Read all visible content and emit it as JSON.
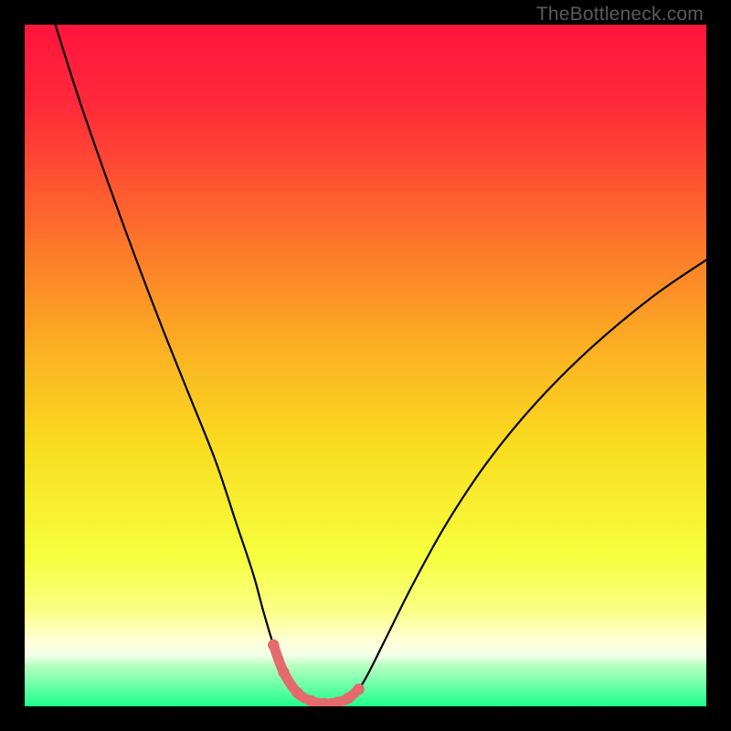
{
  "watermark": "TheBottleneck.com",
  "colors": {
    "frame": "#000000",
    "gradient_top": "#ff163d",
    "gradient_mid": "#f9dd20",
    "gradient_low": "#fbff80",
    "gradient_band": "#f7ffe0",
    "gradient_bottom": "#24ff8d",
    "curve": "#000000",
    "highlight": "#e46a6e"
  },
  "chart_data": {
    "type": "line",
    "title": "",
    "xlabel": "",
    "ylabel": "",
    "xlim": [
      0,
      100
    ],
    "ylim": [
      0,
      100
    ],
    "series": [
      {
        "name": "bottleneck-curve",
        "x": [
          4.5,
          8,
          12,
          16,
          20,
          24,
          28,
          31,
          33.5,
          35,
          36.5,
          38,
          40,
          42,
          44,
          46,
          47.5,
          49,
          50.5,
          53,
          57,
          62,
          68,
          75,
          83,
          92,
          100
        ],
        "y": [
          100,
          89,
          77.5,
          66.5,
          56,
          46,
          36,
          27,
          19.5,
          14,
          9,
          5,
          2,
          0.8,
          0.4,
          0.6,
          1.2,
          2.5,
          5,
          10,
          18,
          27,
          36,
          44.5,
          52.5,
          60,
          65.5
        ]
      },
      {
        "name": "optimal-band",
        "x": [
          36.5,
          38,
          40,
          42,
          44,
          46,
          47.5,
          49
        ],
        "y": [
          9,
          5,
          2,
          0.8,
          0.4,
          0.6,
          1.2,
          2.5
        ]
      }
    ],
    "annotations": []
  }
}
